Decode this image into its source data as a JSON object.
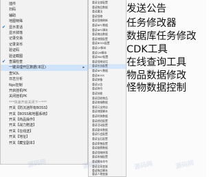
{
  "left_menu": {
    "items": [
      {
        "label": "插件"
      },
      {
        "label": "扫码"
      },
      {
        "label": "辅助"
      },
      {
        "label": "地图特殊"
      },
      {
        "label": "显示发话"
      },
      {
        "label": "显示掉落"
      },
      {
        "label": "记录交易"
      },
      {
        "label": "记录货币"
      },
      {
        "label": "验证码"
      },
      {
        "label": "验证截图"
      },
      {
        "label": "查漏检查"
      },
      {
        "label": "一键清理开区数据(本区)"
      },
      {
        "label": "查SQL"
      },
      {
        "label": "日志分析"
      },
      {
        "label": "Npc控制"
      },
      {
        "label": "开启挂机PK"
      },
      {
        "label": "关闭挂机PK"
      },
      {
        "label": "***快速开启关闭下一***"
      },
      {
        "label": "开关【防沉迷所有BOSS】"
      },
      {
        "label": "开关【BOSS和地图系统】"
      },
      {
        "label": "开关【商品操作】"
      },
      {
        "label": "开关【战力赠送】"
      },
      {
        "label": "开关【在线送】"
      },
      {
        "label": "开关【地址】"
      },
      {
        "label": "开关【藏宝副本】"
      }
    ]
  },
  "sub_menu": {
    "items": [
      {
        "label": "重读全部配置"
      },
      {
        "label": "重读物品数据"
      },
      {
        "label": "重读魔法"
      },
      {
        "label": "重读怪物"
      },
      {
        "label": "重读怪物刷新"
      },
      {
        "label": "重读NPC数据"
      },
      {
        "label": "重读NPC脚本"
      },
      {
        "label": "重读商店数据"
      },
      {
        "label": "重读地图配置"
      },
      {
        "label": "重读BOSS配置"
      },
      {
        "label": "重读QF脚本"
      },
      {
        "label": "重读QM脚本"
      },
      {
        "label": "重读MAP配置"
      },
      {
        "label": "重读怪物说话"
      },
      {
        "label": "重读任务配置"
      },
      {
        "label": "重读NPC数据"
      },
      {
        "label": "重读BOSS"
      },
      {
        "label": "重读装备"
      },
      {
        "label": "重读公告"
      },
      {
        "label": "重读称号"
      },
      {
        "label": "重读技能"
      },
      {
        "label": "重读回收物品"
      },
      {
        "label": "重读商城数据"
      },
      {
        "label": "重读元宝商店"
      },
      {
        "label": "重读地图脚本"
      },
      {
        "label": "重读时装数据"
      },
      {
        "label": "重读经验配置"
      },
      {
        "label": "重读活动配置"
      },
      {
        "label": "重读副本数据"
      },
      {
        "label": "重读行会配置"
      },
      {
        "label": "重读宝石配置"
      },
      {
        "label": "重读寄售配置"
      },
      {
        "label": "重读翅膀数据"
      },
      {
        "label": "重读怪物掉落"
      },
      {
        "label": "重读攻城配置"
      },
      {
        "label": "重读脚本命令"
      },
      {
        "label": "重读全局变量"
      },
      {
        "label": "重读物品脚本"
      },
      {
        "label": "重读人物变量"
      }
    ]
  },
  "callouts": [
    {
      "text": "发送公告"
    },
    {
      "text": "任务修改器"
    },
    {
      "text": "数据库任务修改"
    },
    {
      "text": "CDK工具"
    },
    {
      "text": "在线查询工具"
    },
    {
      "text": "物品数据修改"
    },
    {
      "text": "怪物数据控制"
    }
  ],
  "watermarks": [
    {
      "text": "源码网"
    },
    {
      "text": "源码网"
    },
    {
      "text": "源码网"
    },
    {
      "text": "源码网"
    }
  ]
}
